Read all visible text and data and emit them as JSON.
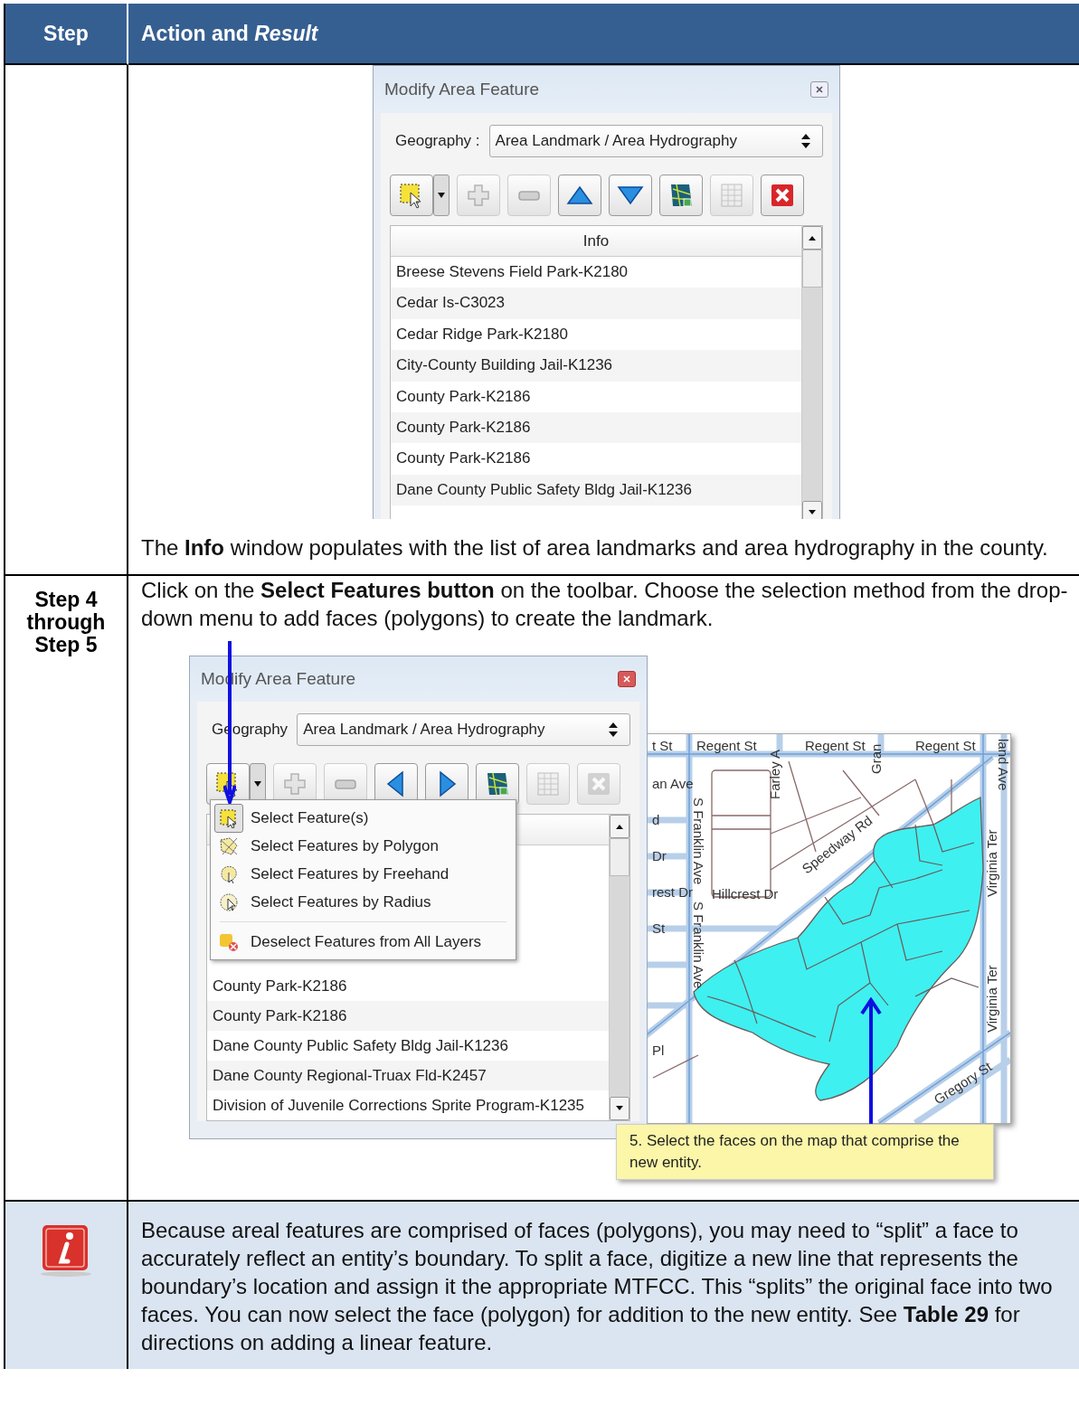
{
  "table": {
    "columns": [
      {
        "text": "Step"
      },
      {
        "text": "Action and *Result*"
      }
    ],
    "row_1": {
      "dialog": {
        "title": "Modify Area Feature",
        "geography_label": "Geography :",
        "geography_value": "Area Landmark / Area Hydrography",
        "toolbar": [
          {
            "kind": "select",
            "disabled": false
          },
          {
            "kind": "add",
            "disabled": true
          },
          {
            "kind": "remove",
            "disabled": true
          },
          {
            "kind": "up",
            "disabled": false
          },
          {
            "kind": "down",
            "disabled": false
          },
          {
            "kind": "map",
            "disabled": false
          },
          {
            "kind": "table",
            "disabled": true
          },
          {
            "kind": "close",
            "disabled": false
          }
        ],
        "list_header": "Info",
        "list": [
          "Breese Stevens Field Park-K2180",
          "Cedar Is-C3023",
          "Cedar Ridge Park-K2180",
          "City-County Building Jail-K1236",
          "County Park-K2186",
          "County Park-K2186",
          "County Park-K2186",
          "Dane County Public Safety Bldg Jail-K1236"
        ]
      },
      "text": "The **Info** window populates with the list of area landmarks and area hydrography in the county."
    },
    "row_2": {
      "step": "Step 4 through Step 5",
      "text": "Click on the **Select Features button** on the toolbar. Choose the selection method from the drop-down menu to add faces (polygons) to create the landmark.",
      "dialog": {
        "title": "Modify Area Feature",
        "geography_label": "Geography",
        "geography_value": "Area Landmark / Area Hydrography",
        "toolbar": [
          {
            "kind": "select",
            "disabled": false
          },
          {
            "kind": "add",
            "disabled": true
          },
          {
            "kind": "remove",
            "disabled": true
          },
          {
            "kind": "left",
            "disabled": false
          },
          {
            "kind": "right",
            "disabled": false
          },
          {
            "kind": "map",
            "disabled": false
          },
          {
            "kind": "table",
            "disabled": true
          },
          {
            "kind": "close",
            "disabled": true
          }
        ],
        "list": [
          "County Park-K2186",
          "County Park-K2186",
          "Dane County Public Safety Bldg Jail-K1236",
          "Dane County Regional-Truax Fld-K2457",
          "Division of Juvenile Corrections Sprite Program-K1235"
        ]
      },
      "menu": [
        {
          "kind": "select",
          "label": "Select Feature(s)",
          "selected": true
        },
        {
          "kind": "polygon",
          "label": "Select Features by Polygon",
          "selected": false
        },
        {
          "kind": "freehand",
          "label": "Select Features by Freehand",
          "selected": false
        },
        {
          "kind": "radius",
          "label": "Select Features by Radius",
          "selected": false
        },
        {
          "kind": "deselect",
          "label": "Deselect Features from All Layers",
          "selected": false
        }
      ],
      "map_labels": [
        "t St",
        "Regent St",
        "Farley A",
        "Regent St",
        "Gran",
        "Regent St",
        "an Ave",
        "d",
        "Dr",
        "rest Dr",
        "Hillcrest Dr",
        "St",
        "S Franklin Ave",
        "S Franklin Ave",
        "Speedway Rd",
        "Virginia Ter",
        "Virginia Ter",
        "land Ave",
        "Gregory St",
        "Pl"
      ],
      "callout": "5. Select the faces on the map that comprise the new entity."
    },
    "note": {
      "text": "Because areal features are comprised of faces (polygons), you may need to “split” a face to accurately reflect an entity’s boundary. To split a face, digitize a new line that represents the boundary’s location and assign it the appropriate MTFCC. This “splits” the original face into two faces. You can now select the face (polygon) for addition to the new entity. See **Table 29** for directions on adding a linear feature."
    }
  }
}
